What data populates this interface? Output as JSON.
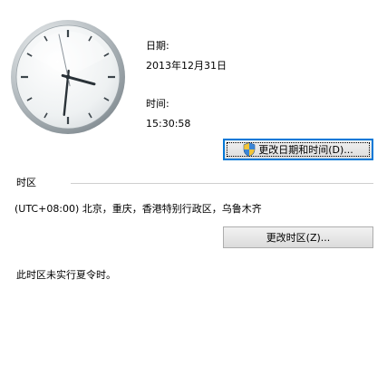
{
  "date": {
    "label": "日期:",
    "value": "2013年12月31日"
  },
  "time": {
    "label": "时间:",
    "value": "15:30:58"
  },
  "change_datetime_button": {
    "label": "更改日期和时间(D)...",
    "icon": "uac-shield-icon"
  },
  "timezone": {
    "section_label": "时区",
    "value": "(UTC+08:00) 北京，重庆，香港特别行政区，乌鲁木齐",
    "change_button_label": "更改时区(Z)...",
    "dst_note": "此时区未实行夏令时。"
  },
  "clock": {
    "hours": 15,
    "minutes": 30,
    "seconds": 58
  },
  "colors": {
    "focus_accent": "#0078d7",
    "clock_hand": "#2a3238",
    "clock_second_hand": "#8a9299"
  }
}
